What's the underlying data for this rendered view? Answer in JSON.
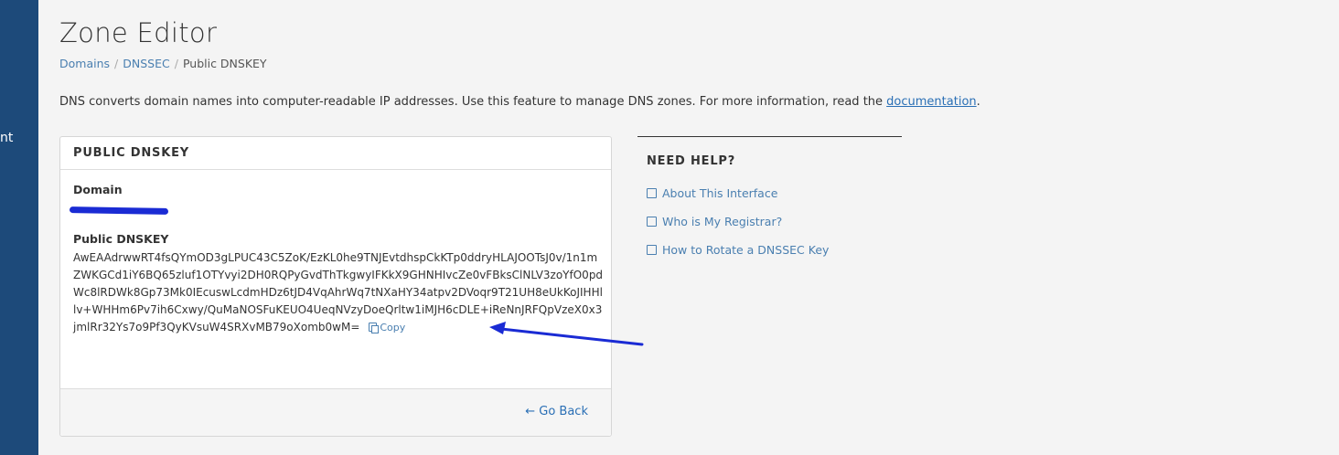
{
  "sidebar": {
    "fragment_text": "nt"
  },
  "page": {
    "title": "Zone Editor",
    "breadcrumb": [
      "Domains",
      "DNSSEC",
      "Public DNSKEY"
    ],
    "description_text": "DNS converts domain names into computer-readable IP addresses. Use this feature to manage DNS zones. For more information, read the ",
    "description_link": "documentation",
    "description_end": "."
  },
  "panel": {
    "heading": "PUBLIC DNSKEY",
    "domain_label": "Domain",
    "domain_value": "",
    "dnskey_label": "Public DNSKEY",
    "dnskey_value": "AwEAAdrwwRT4fsQYmOD3gLPUC43C5ZoK/EzKL0he9TNJEvtdhspCkKTp0ddryHLAJOOTsJ0v/1n1mZWKGCd1iY6BQ65zluf1OTYvyi2DH0RQPyGvdThTkgwyIFKkX9GHNHIvcZe0vFBksClNLV3zoYfO0pdWc8lRDWk8Gp73Mk0IEcuswLcdmHDz6tJD4VqAhrWq7tNXaHY34atpv2DVoqr9T21UH8eUkKoJIHHllv+WHHm6Pv7ih6Cxwy/QuMaNOSFuKEUO4UeqNVzyDoeQrltw1iMJH6cDLE+iReNnJRFQpVzeX0x3jmlRr32Ys7o9Pf3QyKVsuW4SRXvMB79oXomb0wM=",
    "copy_label": "Copy",
    "go_back_label": "Go Back"
  },
  "help": {
    "title": "NEED HELP?",
    "links": [
      "About This Interface",
      "Who is My Registrar?",
      "How to Rotate a DNSSEC Key"
    ]
  },
  "colors": {
    "sidebar": "#1d4a7a",
    "link": "#4a7fb0",
    "annotation": "#1a2bd4"
  }
}
